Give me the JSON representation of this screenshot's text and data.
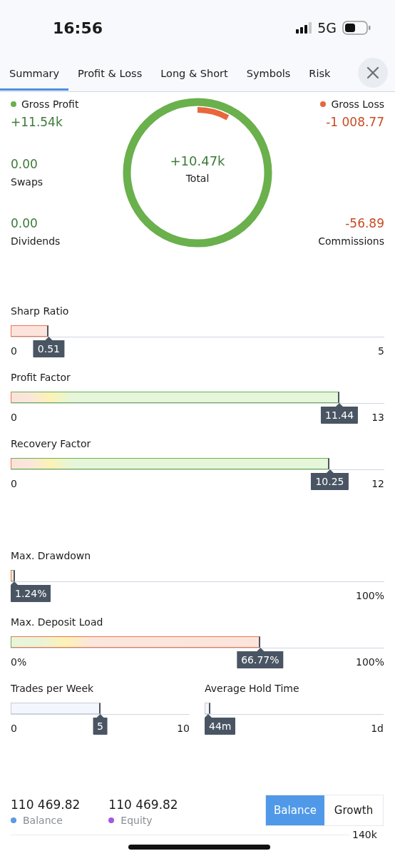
{
  "status_bar": {
    "time": "16:56",
    "network": "5G"
  },
  "tabs": [
    {
      "label": "Summary",
      "selected": true
    },
    {
      "label": "Profit & Loss",
      "selected": false
    },
    {
      "label": "Long & Short",
      "selected": false
    },
    {
      "label": "Symbols",
      "selected": false
    },
    {
      "label": "Risk",
      "selected": false
    }
  ],
  "summary": {
    "ring": {
      "level": 0.08
    },
    "total": {
      "value": "+10.47k",
      "label": "Total"
    },
    "gross_profit": {
      "label": "Gross Profit",
      "value": "+11.54k",
      "color": "#6ab04c"
    },
    "gross_loss": {
      "label": "Gross Loss",
      "value": "-1 008.77",
      "color": "#e8673c"
    },
    "left_stats": [
      {
        "value": "0.00",
        "label": "Swaps"
      },
      {
        "value": "0.00",
        "label": "Dividends"
      }
    ],
    "right_stats": [
      {
        "value": "-56.89",
        "label": "Commissions"
      }
    ]
  },
  "ratios": [
    {
      "label": "Sharp Ratio",
      "min": "0",
      "max": "5",
      "value": "0.51",
      "level": 0.102,
      "kind": "bad"
    },
    {
      "label": "Profit Factor",
      "min": "0",
      "max": "13",
      "value": "11.44",
      "level": 0.88,
      "kind": "good"
    },
    {
      "label": "Recovery Factor",
      "min": "0",
      "max": "12",
      "value": "10.25",
      "level": 0.854,
      "kind": "good"
    }
  ],
  "risks": [
    {
      "label": "Max. Drawdown",
      "max": "100%",
      "value": "1.24%",
      "level": 0.0124,
      "kind": "good"
    },
    {
      "label": "Max. Deposit Load",
      "min": "0%",
      "max": "100%",
      "value": "66.77%",
      "level": 0.6677,
      "kind": "risk"
    }
  ],
  "activity": [
    {
      "label": "Trades per Week",
      "min": "0",
      "max": "10",
      "value": "5",
      "level": 0.5,
      "kind": "neutral"
    },
    {
      "label": "Average Hold Time",
      "max": "1d",
      "value": "44m",
      "level": 0.03,
      "kind": "neutral"
    }
  ],
  "legend": [
    {
      "value": "110 469.82",
      "label": "Balance",
      "color": "#5b9be0"
    },
    {
      "value": "110 469.82",
      "label": "Equity",
      "color": "#a259e0"
    }
  ],
  "chart_toggle": [
    {
      "label": "Balance",
      "selected": true
    },
    {
      "label": "Growth",
      "selected": false
    }
  ],
  "chart_axis": {
    "label": "140k"
  }
}
